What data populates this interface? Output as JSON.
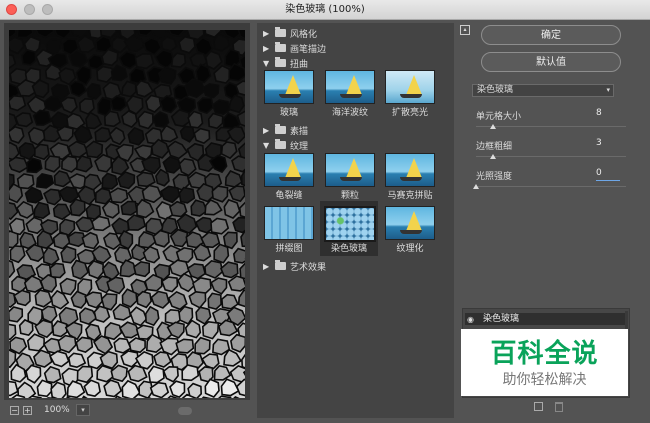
{
  "window": {
    "title": "染色玻璃 (100%)"
  },
  "status": {
    "zoom": "100%"
  },
  "gallery": {
    "categories": {
      "fengge": "风格化",
      "huabi": "画笔描边",
      "niuqu": "扭曲",
      "sumiao": "素描",
      "wenli": "纹理",
      "yishu": "艺术效果"
    },
    "distort_thumbs": [
      "玻璃",
      "海洋波纹",
      "扩散亮光"
    ],
    "texture_thumbs": [
      "龟裂缝",
      "颗粒",
      "马赛克拼贴",
      "拼缀图",
      "染色玻璃",
      "纹理化"
    ]
  },
  "panel": {
    "ok_label": "确定",
    "default_label": "默认值",
    "filter_name": "染色玻璃",
    "params": [
      {
        "label": "单元格大小",
        "value": "8",
        "fraction": 0.11
      },
      {
        "label": "边框粗细",
        "value": "3",
        "fraction": 0.11
      },
      {
        "label": "光照强度",
        "value": "0",
        "fraction": 0.0
      }
    ]
  },
  "layers": {
    "item_label": "染色玻璃"
  },
  "watermark": {
    "big": "百科全说",
    "small": "助你轻松解决"
  },
  "colors": {
    "watermark_green": "#0aa35a",
    "panel_bg": "#535353"
  }
}
